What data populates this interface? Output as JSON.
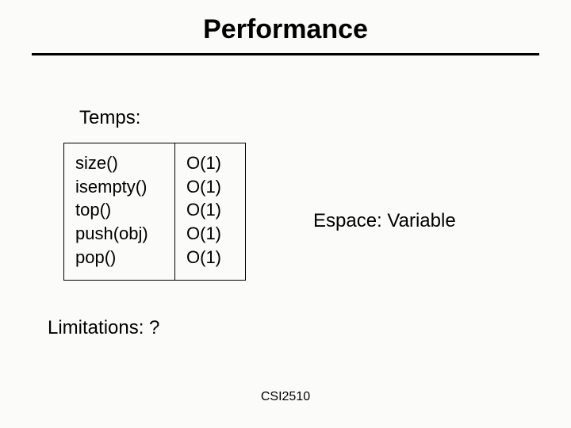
{
  "title": "Performance",
  "temps_label": "Temps:",
  "ops": {
    "r0": "size()",
    "r1": "isempty()",
    "r2": "top()",
    "r3": "push(obj)",
    "r4": "pop()"
  },
  "big": {
    "r0": "O(1)",
    "r1": "O(1)",
    "r2": "O(1)",
    "r3": "O(1)",
    "r4": "O(1)"
  },
  "espace": "Espace: Variable",
  "limitations": "Limitations: ?",
  "footer": "CSI2510"
}
